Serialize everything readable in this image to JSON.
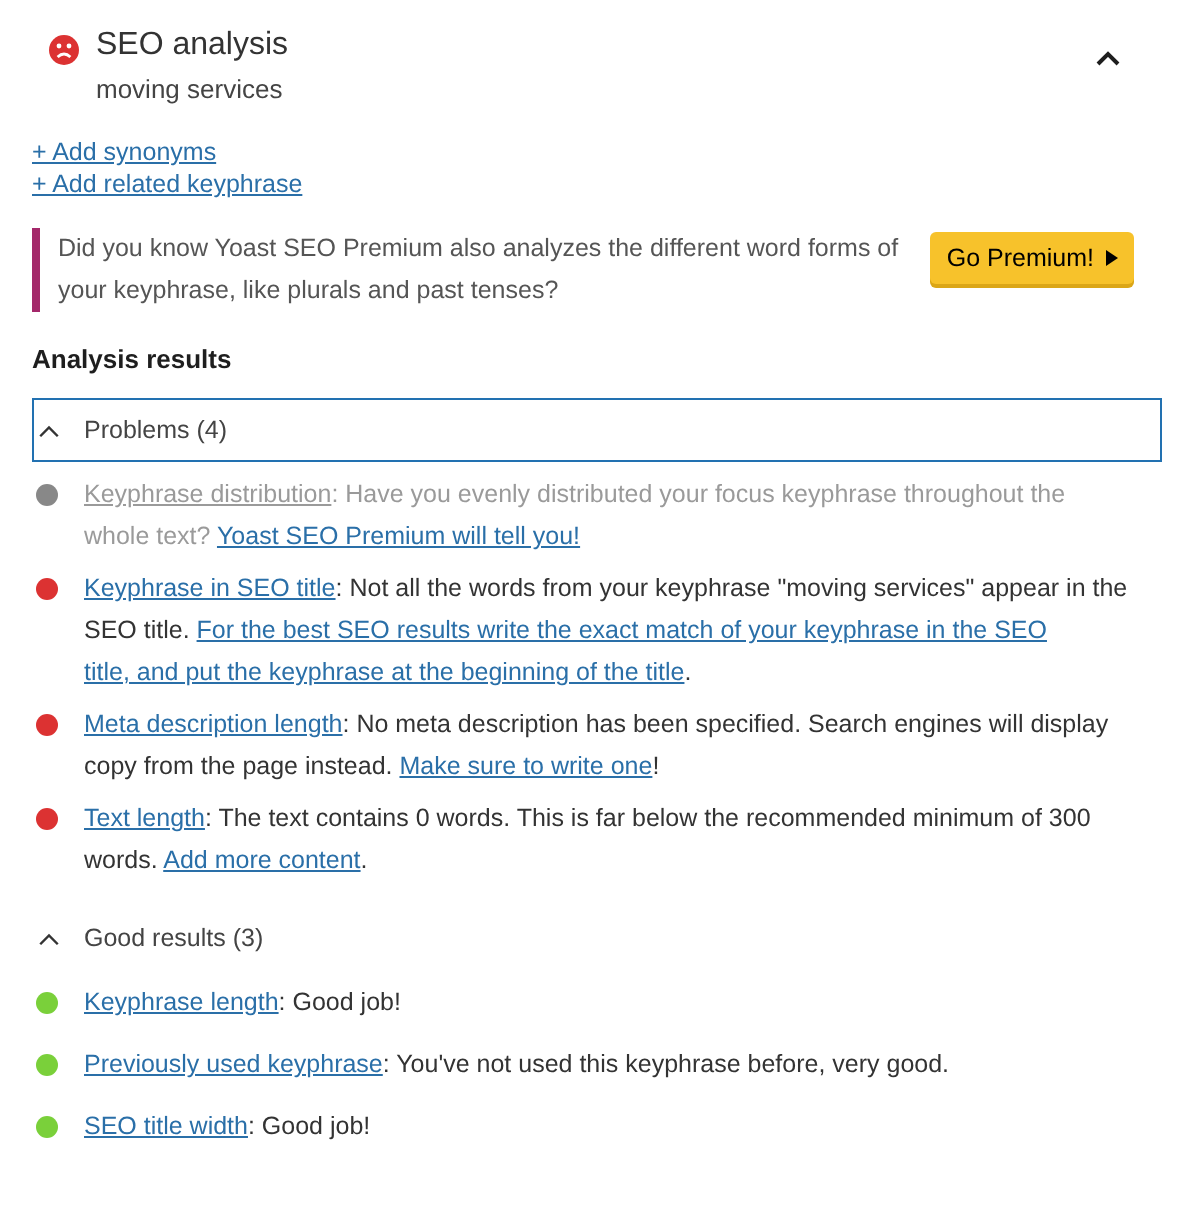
{
  "header": {
    "title": "SEO analysis",
    "subtitle": "moving services",
    "expanded": true
  },
  "links": [
    "+ Add synonyms",
    "+ Add related keyphrase"
  ],
  "promo": {
    "text": "Did you know Yoast SEO Premium also analyzes the different word forms of your keyphrase, like plurals and past tenses?",
    "button": "Go Premium!"
  },
  "results_heading": "Analysis results",
  "sections": [
    {
      "title": "Problems (4)",
      "expanded": true,
      "focused": true,
      "items": [
        {
          "color": "#888888",
          "muted": true,
          "parts": [
            {
              "kind": "link",
              "text": "Keyphrase distribution"
            },
            {
              "kind": "text",
              "text": ": Have you evenly distributed your focus keyphrase throughout the whole text? "
            },
            {
              "kind": "link",
              "text": "Yoast SEO Premium will tell you!"
            }
          ]
        },
        {
          "color": "#dc3232",
          "muted": false,
          "parts": [
            {
              "kind": "link",
              "text": "Keyphrase in SEO title"
            },
            {
              "kind": "text",
              "text": ": Not all the words from your keyphrase \"moving services\" appear in the SEO title. "
            },
            {
              "kind": "link",
              "text": "For the best SEO results write the exact match of your keyphrase in the SEO"
            },
            {
              "kind": "link",
              "text": "title, and put the keyphrase at the beginning of the title"
            },
            {
              "kind": "text",
              "text": "."
            }
          ]
        },
        {
          "color": "#dc3232",
          "muted": false,
          "parts": [
            {
              "kind": "link",
              "text": "Meta description length"
            },
            {
              "kind": "text",
              "text": ": No meta description has been specified. Search engines will display copy from the page instead. "
            },
            {
              "kind": "link",
              "text": "Make sure to write one"
            },
            {
              "kind": "text",
              "text": "!"
            }
          ]
        },
        {
          "color": "#dc3232",
          "muted": false,
          "parts": [
            {
              "kind": "link",
              "text": "Text length"
            },
            {
              "kind": "text",
              "text": ": The text contains 0 words. This is far below the recommended minimum of 300 words. "
            },
            {
              "kind": "link",
              "text": "Add more content"
            },
            {
              "kind": "text",
              "text": "."
            }
          ]
        }
      ]
    },
    {
      "title": "Good results (3)",
      "expanded": true,
      "focused": false,
      "items": [
        {
          "color": "#7ad03a",
          "muted": false,
          "parts": [
            {
              "kind": "link",
              "text": "Keyphrase length"
            },
            {
              "kind": "text",
              "text": ": Good job!"
            }
          ]
        },
        {
          "color": "#7ad03a",
          "muted": false,
          "parts": [
            {
              "kind": "link",
              "text": "Previously used keyphrase"
            },
            {
              "kind": "text",
              "text": ": You've not used this keyphrase before, very good."
            }
          ]
        },
        {
          "color": "#7ad03a",
          "muted": false,
          "parts": [
            {
              "kind": "link",
              "text": "SEO title width"
            },
            {
              "kind": "text",
              "text": ": Good job!"
            }
          ]
        }
      ]
    }
  ]
}
